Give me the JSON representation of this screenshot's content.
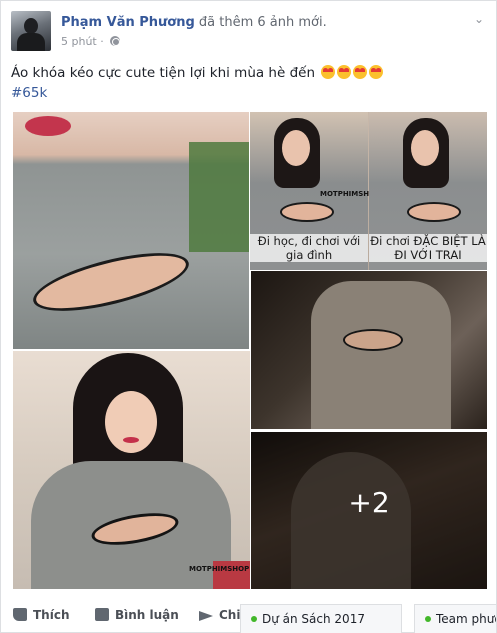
{
  "post": {
    "author": "Phạm Văn Phương",
    "action": "đã thêm 6 ảnh mới.",
    "time": "5 phút",
    "text": "Áo khóa kéo cực cute tiện lợi khi mùa hè đến",
    "emoji_count": 4,
    "hashtag": "#65k"
  },
  "photos": {
    "caption_left": "Đi học, đi chơi với gia đình",
    "caption_right": "Đi chơi ĐẶC BIỆT LÀ ĐI VỚI TRAI",
    "watermark": "MOTPHIMSHOP",
    "more_count": "+2"
  },
  "actions": {
    "like": "Thích",
    "comment": "Bình luận",
    "share": "Chia"
  },
  "chat_tabs": [
    {
      "label": "Dự án Sách 2017"
    },
    {
      "label": "Team phượt"
    }
  ],
  "colors": {
    "link": "#365899",
    "online": "#42b72a",
    "muted": "#90949c"
  }
}
